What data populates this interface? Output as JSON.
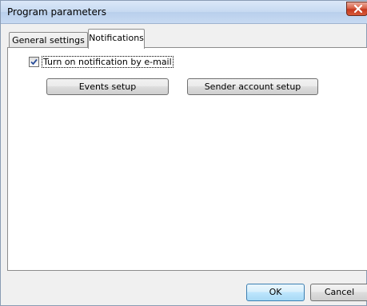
{
  "window": {
    "title": "Program parameters"
  },
  "tabs": [
    {
      "label": "General settings",
      "selected": false
    },
    {
      "label": "Notifications",
      "selected": true
    }
  ],
  "notifications": {
    "email_checkbox_label": "Turn on notification by e-mail",
    "email_checkbox_checked": true,
    "events_setup_label": "Events setup",
    "sender_account_setup_label": "Sender account setup"
  },
  "footer": {
    "ok_label": "OK",
    "cancel_label": "Cancel"
  },
  "icons": {
    "close": "close-icon",
    "checkbox_mark": "checkmark-icon"
  },
  "colors": {
    "close_button": "#c4381f",
    "ok_button_border": "#3c7fb1",
    "title_bar": "#c6d9f1"
  }
}
